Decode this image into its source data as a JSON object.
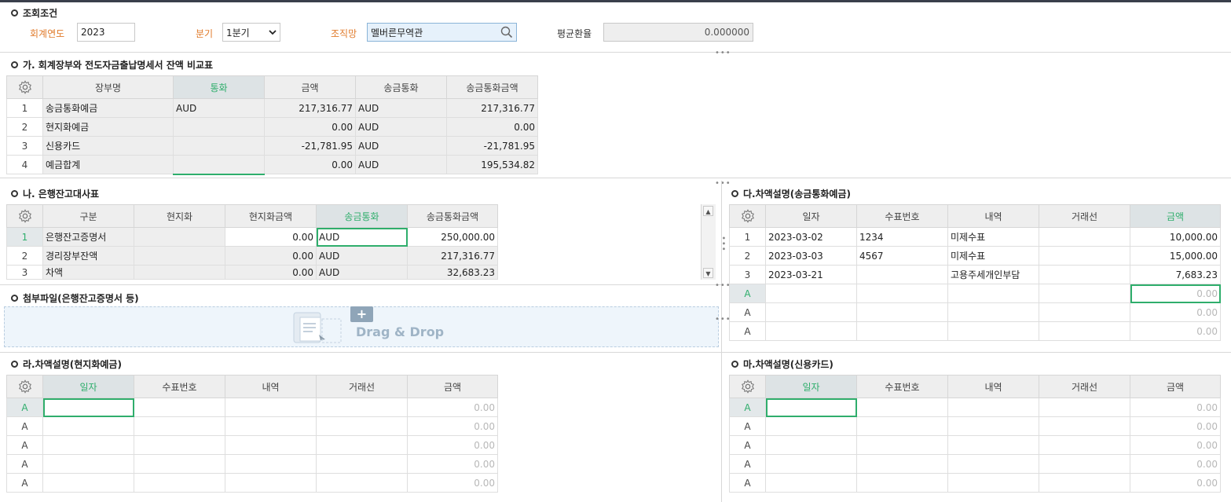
{
  "query": {
    "title": "조회조건",
    "fiscal_year_label": "회계연도",
    "fiscal_year_value": "2023",
    "quarter_label": "분기",
    "quarter_value": "1분기",
    "org_label": "조직망",
    "org_value": "멜버른무역관",
    "avg_rate_label": "평균환율",
    "avg_rate_value": "0.000000"
  },
  "section_ga": {
    "title": "가. 회계장부와 전도자금출납명세서 잔액 비교표",
    "headers": [
      "장부명",
      "통화",
      "금액",
      "송금통화",
      "송금통화금액"
    ],
    "rows": [
      {
        "no": "1",
        "name": "송금통화예금",
        "currency": "AUD",
        "amount": "217,316.77",
        "remit_currency": "AUD",
        "remit_amount": "217,316.77"
      },
      {
        "no": "2",
        "name": "현지화예금",
        "currency": "",
        "amount": "0.00",
        "remit_currency": "AUD",
        "remit_amount": "0.00"
      },
      {
        "no": "3",
        "name": "신용카드",
        "currency": "",
        "amount": "-21,781.95",
        "remit_currency": "AUD",
        "remit_amount": "-21,781.95"
      },
      {
        "no": "4",
        "name": "예금합계",
        "currency": "",
        "amount": "0.00",
        "remit_currency": "AUD",
        "remit_amount": "195,534.82"
      }
    ]
  },
  "section_na": {
    "title": "나. 은행잔고대사표",
    "headers": [
      "구분",
      "현지화",
      "현지화금액",
      "송금통화",
      "송금통화금액"
    ],
    "rows": [
      {
        "no": "1",
        "name": "은행잔고증명서",
        "local": "",
        "local_amount": "0.00",
        "remit_currency": "AUD",
        "remit_amount": "250,000.00"
      },
      {
        "no": "2",
        "name": "경리장부잔액",
        "local": "",
        "local_amount": "0.00",
        "remit_currency": "AUD",
        "remit_amount": "217,316.77"
      },
      {
        "no": "3",
        "name": "차액",
        "local": "",
        "local_amount": "0.00",
        "remit_currency": "AUD",
        "remit_amount": "32,683.23"
      }
    ]
  },
  "section_da": {
    "title": "다.차액설명(송금통화예금)",
    "headers": [
      "일자",
      "수표번호",
      "내역",
      "거래선",
      "금액"
    ],
    "rows": [
      {
        "no": "1",
        "date": "2023-03-02",
        "check": "1234",
        "desc": "미제수표",
        "partner": "",
        "amount": "10,000.00"
      },
      {
        "no": "2",
        "date": "2023-03-03",
        "check": "4567",
        "desc": "미제수표",
        "partner": "",
        "amount": "15,000.00"
      },
      {
        "no": "3",
        "date": "2023-03-21",
        "check": "",
        "desc": "고용주세개인부담",
        "partner": "",
        "amount": "7,683.23"
      },
      {
        "no": "A",
        "date": "",
        "check": "",
        "desc": "",
        "partner": "",
        "amount": "0.00"
      },
      {
        "no": "A",
        "date": "",
        "check": "",
        "desc": "",
        "partner": "",
        "amount": "0.00"
      },
      {
        "no": "A",
        "date": "",
        "check": "",
        "desc": "",
        "partner": "",
        "amount": "0.00"
      }
    ]
  },
  "section_attach": {
    "title": "첨부파일(은행잔고증명서 등)",
    "drop_text": "Drag & Drop",
    "plus": "+"
  },
  "section_ra": {
    "title": "라.차액설명(현지화예금)",
    "headers": [
      "일자",
      "수표번호",
      "내역",
      "거래선",
      "금액"
    ],
    "rows": [
      {
        "no": "A",
        "amount": "0.00"
      },
      {
        "no": "A",
        "amount": "0.00"
      },
      {
        "no": "A",
        "amount": "0.00"
      },
      {
        "no": "A",
        "amount": "0.00"
      },
      {
        "no": "A",
        "amount": "0.00"
      }
    ]
  },
  "section_ma": {
    "title": "마.차액설명(신용카드)",
    "headers": [
      "일자",
      "수표번호",
      "내역",
      "거래선",
      "금액"
    ],
    "rows": [
      {
        "no": "A",
        "amount": "0.00"
      },
      {
        "no": "A",
        "amount": "0.00"
      },
      {
        "no": "A",
        "amount": "0.00"
      },
      {
        "no": "A",
        "amount": "0.00"
      },
      {
        "no": "A",
        "amount": "0.00"
      }
    ]
  },
  "icons": {
    "settings": "gear-icon",
    "search": "search-icon",
    "dropdown": "chevron-down-icon",
    "scroll_up": "scroll-up-icon",
    "scroll_down": "scroll-down-icon",
    "file": "file-icon"
  },
  "colors": {
    "accent_green": "#2fae6c",
    "label_orange": "#e07a2a",
    "header_bg": "#eeeeee",
    "search_bg": "#e6f1fb"
  }
}
